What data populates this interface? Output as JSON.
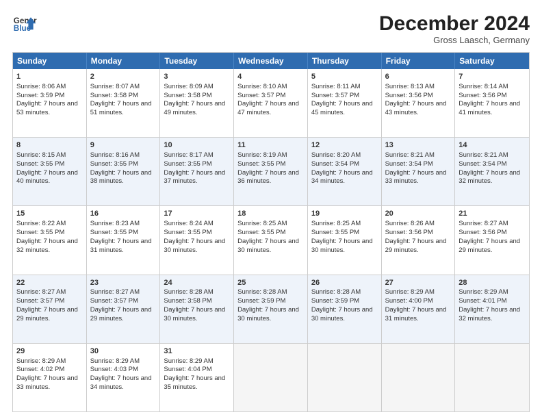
{
  "header": {
    "logo_line1": "General",
    "logo_line2": "Blue",
    "month": "December 2024",
    "location": "Gross Laasch, Germany"
  },
  "days_of_week": [
    "Sunday",
    "Monday",
    "Tuesday",
    "Wednesday",
    "Thursday",
    "Friday",
    "Saturday"
  ],
  "weeks": [
    [
      {
        "day": "1",
        "sunrise": "8:06 AM",
        "sunset": "3:59 PM",
        "daylight": "7 hours and 53 minutes."
      },
      {
        "day": "2",
        "sunrise": "8:07 AM",
        "sunset": "3:58 PM",
        "daylight": "7 hours and 51 minutes."
      },
      {
        "day": "3",
        "sunrise": "8:09 AM",
        "sunset": "3:58 PM",
        "daylight": "7 hours and 49 minutes."
      },
      {
        "day": "4",
        "sunrise": "8:10 AM",
        "sunset": "3:57 PM",
        "daylight": "7 hours and 47 minutes."
      },
      {
        "day": "5",
        "sunrise": "8:11 AM",
        "sunset": "3:57 PM",
        "daylight": "7 hours and 45 minutes."
      },
      {
        "day": "6",
        "sunrise": "8:13 AM",
        "sunset": "3:56 PM",
        "daylight": "7 hours and 43 minutes."
      },
      {
        "day": "7",
        "sunrise": "8:14 AM",
        "sunset": "3:56 PM",
        "daylight": "7 hours and 41 minutes."
      }
    ],
    [
      {
        "day": "8",
        "sunrise": "8:15 AM",
        "sunset": "3:55 PM",
        "daylight": "7 hours and 40 minutes."
      },
      {
        "day": "9",
        "sunrise": "8:16 AM",
        "sunset": "3:55 PM",
        "daylight": "7 hours and 38 minutes."
      },
      {
        "day": "10",
        "sunrise": "8:17 AM",
        "sunset": "3:55 PM",
        "daylight": "7 hours and 37 minutes."
      },
      {
        "day": "11",
        "sunrise": "8:19 AM",
        "sunset": "3:55 PM",
        "daylight": "7 hours and 36 minutes."
      },
      {
        "day": "12",
        "sunrise": "8:20 AM",
        "sunset": "3:54 PM",
        "daylight": "7 hours and 34 minutes."
      },
      {
        "day": "13",
        "sunrise": "8:21 AM",
        "sunset": "3:54 PM",
        "daylight": "7 hours and 33 minutes."
      },
      {
        "day": "14",
        "sunrise": "8:21 AM",
        "sunset": "3:54 PM",
        "daylight": "7 hours and 32 minutes."
      }
    ],
    [
      {
        "day": "15",
        "sunrise": "8:22 AM",
        "sunset": "3:55 PM",
        "daylight": "7 hours and 32 minutes."
      },
      {
        "day": "16",
        "sunrise": "8:23 AM",
        "sunset": "3:55 PM",
        "daylight": "7 hours and 31 minutes."
      },
      {
        "day": "17",
        "sunrise": "8:24 AM",
        "sunset": "3:55 PM",
        "daylight": "7 hours and 30 minutes."
      },
      {
        "day": "18",
        "sunrise": "8:25 AM",
        "sunset": "3:55 PM",
        "daylight": "7 hours and 30 minutes."
      },
      {
        "day": "19",
        "sunrise": "8:25 AM",
        "sunset": "3:55 PM",
        "daylight": "7 hours and 30 minutes."
      },
      {
        "day": "20",
        "sunrise": "8:26 AM",
        "sunset": "3:56 PM",
        "daylight": "7 hours and 29 minutes."
      },
      {
        "day": "21",
        "sunrise": "8:27 AM",
        "sunset": "3:56 PM",
        "daylight": "7 hours and 29 minutes."
      }
    ],
    [
      {
        "day": "22",
        "sunrise": "8:27 AM",
        "sunset": "3:57 PM",
        "daylight": "7 hours and 29 minutes."
      },
      {
        "day": "23",
        "sunrise": "8:27 AM",
        "sunset": "3:57 PM",
        "daylight": "7 hours and 29 minutes."
      },
      {
        "day": "24",
        "sunrise": "8:28 AM",
        "sunset": "3:58 PM",
        "daylight": "7 hours and 30 minutes."
      },
      {
        "day": "25",
        "sunrise": "8:28 AM",
        "sunset": "3:59 PM",
        "daylight": "7 hours and 30 minutes."
      },
      {
        "day": "26",
        "sunrise": "8:28 AM",
        "sunset": "3:59 PM",
        "daylight": "7 hours and 30 minutes."
      },
      {
        "day": "27",
        "sunrise": "8:29 AM",
        "sunset": "4:00 PM",
        "daylight": "7 hours and 31 minutes."
      },
      {
        "day": "28",
        "sunrise": "8:29 AM",
        "sunset": "4:01 PM",
        "daylight": "7 hours and 32 minutes."
      }
    ],
    [
      {
        "day": "29",
        "sunrise": "8:29 AM",
        "sunset": "4:02 PM",
        "daylight": "7 hours and 33 minutes."
      },
      {
        "day": "30",
        "sunrise": "8:29 AM",
        "sunset": "4:03 PM",
        "daylight": "7 hours and 34 minutes."
      },
      {
        "day": "31",
        "sunrise": "8:29 AM",
        "sunset": "4:04 PM",
        "daylight": "7 hours and 35 minutes."
      },
      null,
      null,
      null,
      null
    ]
  ]
}
